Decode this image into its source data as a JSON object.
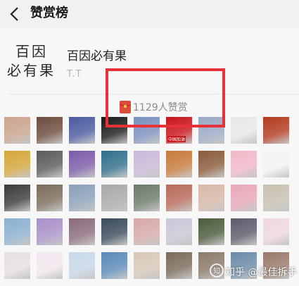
{
  "header": {
    "title": "赞赏榜",
    "back_icon": "chevron-left-icon"
  },
  "profile": {
    "logo_line1": "百因",
    "logo_line2": "必有果",
    "name": "百因必有果",
    "subtitle": "T.T"
  },
  "summary": {
    "icon": "red-envelope-icon",
    "count_text": "1129人赞赏"
  },
  "avatars": [
    {
      "c": "#c9a48d"
    },
    {
      "c": "#6c4b3c"
    },
    {
      "c": "#4a5aa0"
    },
    {
      "c": "#1a1a1a"
    },
    {
      "c": "#7a8fc0"
    },
    {
      "c": "#c8141a",
      "tag": "中国加油"
    },
    {
      "c": "#9aa8c4"
    },
    {
      "c": "#e8e8e8"
    },
    {
      "c": "#b33a1e"
    },
    {
      "c": "#d4a63a"
    },
    {
      "c": "#5a5a5a"
    },
    {
      "c": "#7b5aa8"
    },
    {
      "c": "#2f6e8a"
    },
    {
      "c": "#c9b8d8"
    },
    {
      "c": "#c77a3a"
    },
    {
      "c": "#8a5a3a"
    },
    {
      "c": "#f2b8c8"
    },
    {
      "c": "#f4f4f4"
    },
    {
      "c": "#3a3a3a"
    },
    {
      "c": "#7a6c5a"
    },
    {
      "c": "#8aa0b8"
    },
    {
      "c": "#a8a8a8"
    },
    {
      "c": "#6a7a6a"
    },
    {
      "c": "#b86a5a"
    },
    {
      "c": "#d8b8a8"
    },
    {
      "c": "#e8a8b8"
    },
    {
      "c": "#c8c0b0"
    },
    {
      "c": "#8ab0d0"
    },
    {
      "c": "#a890c8"
    },
    {
      "c": "#8a6a7a"
    },
    {
      "c": "#3a4a5a"
    },
    {
      "c": "#d8a8a8"
    },
    {
      "c": "#c8c8d8"
    },
    {
      "c": "#4a5a3a"
    },
    {
      "c": "#5a5a6a"
    },
    {
      "c": "#f0d8e0"
    },
    {
      "c": "#e8e0e0"
    },
    {
      "c": "#f4e8f0"
    },
    {
      "c": "#c8d8e8"
    },
    {
      "c": "#5a8ab8"
    },
    {
      "c": "#d8c8b8"
    },
    {
      "c": "#7a6a5a"
    },
    {
      "c": "#8a7a6a"
    },
    {
      "c": "#6a8aa8"
    },
    {
      "c": "#9a7a6a"
    }
  ],
  "watermark": {
    "icon": "zhihu-icon",
    "text": "知乎 @最佳拆手"
  },
  "highlight_color": "#e63238"
}
